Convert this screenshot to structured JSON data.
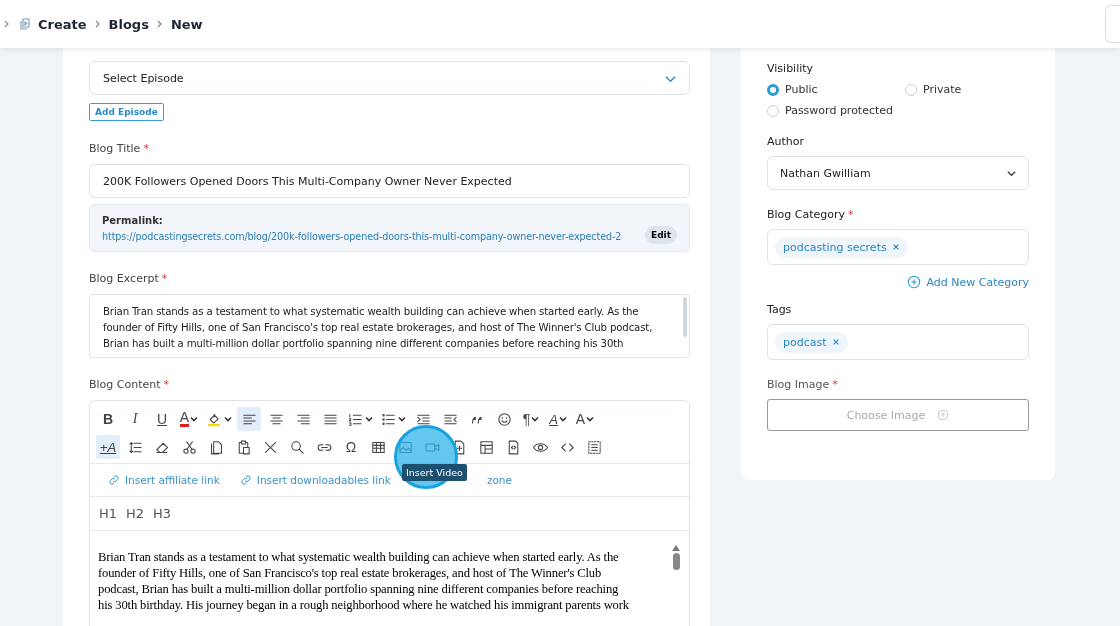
{
  "breadcrumb": [
    "Create",
    "Blogs",
    "New"
  ],
  "episode": {
    "placeholder": "Select Episode",
    "add_button": "Add Episode"
  },
  "title_field": {
    "label": "Blog Title",
    "required_mark": "*",
    "value": "200K Followers Opened Doors This Multi-Company Owner  Never Expected"
  },
  "permalink": {
    "label": "Permalink:",
    "url": "https://podcastingsecrets.com/blog/200k-followers-opened-doors-this-multi-company-owner-never-expected-2",
    "edit_button": "Edit"
  },
  "excerpt": {
    "label": "Blog Excerpt",
    "required_mark": "*",
    "lines": [
      "Brian Tran stands as a testament to what systematic wealth building can achieve when started early. As the",
      "founder of Fifty Hills, one of San Francisco's top real estate brokerages, and host of The Winner's Club podcast,",
      "Brian has built a multi-million dollar portfolio spanning nine different companies before reaching his 30th"
    ]
  },
  "content": {
    "label": "Blog Content",
    "required_mark": "*",
    "toolbar_rows": [
      [
        {
          "kind": "bold",
          "glyph": "B",
          "selected": false,
          "dropdown": false
        },
        {
          "kind": "italic",
          "glyph": "I",
          "selected": false,
          "dropdown": false
        },
        {
          "kind": "underline",
          "glyph": "U",
          "selected": false,
          "dropdown": false
        },
        {
          "kind": "font-color",
          "glyph": "A",
          "selected": false,
          "dropdown": true
        },
        {
          "kind": "highlight",
          "selected": false,
          "dropdown": true
        },
        {
          "kind": "align-left",
          "selected": true,
          "dropdown": false
        },
        {
          "kind": "align-center",
          "selected": false,
          "dropdown": false
        },
        {
          "kind": "align-right",
          "selected": false,
          "dropdown": false
        },
        {
          "kind": "justify",
          "selected": false,
          "dropdown": false
        },
        {
          "kind": "ordered-list",
          "selected": false,
          "dropdown": true
        },
        {
          "kind": "bullet-list",
          "selected": false,
          "dropdown": true
        },
        {
          "kind": "indent",
          "selected": false,
          "dropdown": false
        },
        {
          "kind": "outdent",
          "selected": false,
          "dropdown": false
        },
        {
          "kind": "quote",
          "selected": false,
          "dropdown": false
        },
        {
          "kind": "emoji",
          "selected": false,
          "dropdown": false
        },
        {
          "kind": "paragraph",
          "glyph": "¶",
          "selected": false,
          "dropdown": true
        },
        {
          "kind": "text-direction",
          "glyph": "A",
          "selected": false,
          "dropdown": true
        },
        {
          "kind": "font-size",
          "glyph": "A",
          "selected": false,
          "dropdown": true
        }
      ],
      [
        {
          "kind": "format-text",
          "glyph": "+A",
          "selected": true,
          "dropdown": false
        },
        {
          "kind": "line-height",
          "selected": false,
          "dropdown": false
        },
        {
          "kind": "eraser",
          "selected": false,
          "dropdown": false
        },
        {
          "kind": "cut",
          "selected": false,
          "dropdown": false
        },
        {
          "kind": "copy",
          "selected": false,
          "dropdown": false
        },
        {
          "kind": "paste",
          "selected": false,
          "dropdown": false
        },
        {
          "kind": "clear",
          "selected": false,
          "dropdown": false
        },
        {
          "kind": "search",
          "selected": false,
          "dropdown": false
        },
        {
          "kind": "link",
          "selected": false,
          "dropdown": false
        },
        {
          "kind": "omega",
          "glyph": "Ω",
          "selected": false,
          "dropdown": false
        },
        {
          "kind": "table",
          "selected": false,
          "dropdown": false
        },
        {
          "kind": "image",
          "selected": false,
          "dropdown": false
        },
        {
          "kind": "video",
          "selected": false,
          "dropdown": false
        },
        {
          "kind": "file",
          "selected": false,
          "dropdown": false
        },
        {
          "kind": "template",
          "selected": false,
          "dropdown": false
        },
        {
          "kind": "embed",
          "selected": false,
          "dropdown": false
        },
        {
          "kind": "preview",
          "selected": false,
          "dropdown": false
        },
        {
          "kind": "code",
          "selected": false,
          "dropdown": false
        },
        {
          "kind": "select-all",
          "selected": false,
          "dropdown": false
        }
      ]
    ],
    "tooltip": "Insert Video",
    "links": [
      "Insert affiliate link",
      "Insert downloadables link"
    ],
    "partial_link": "zone",
    "headings": [
      "H1",
      "H2",
      "H3"
    ],
    "body_lines": [
      "Brian Tran stands as a testament to what systematic wealth building can achieve when started early. As the",
      "founder of Fifty Hills, one of San Francisco's top real estate brokerages, and host of The Winner's Club",
      "podcast, Brian has built a multi-million dollar portfolio spanning nine different companies before reaching",
      "his 30th birthday. His journey began in a rough neighborhood where he watched his immigrant parents work"
    ]
  },
  "visibility": {
    "label": "Visibility",
    "options": [
      {
        "label": "Public",
        "selected": true
      },
      {
        "label": "Private",
        "selected": false
      },
      {
        "label": "Password protected",
        "selected": false
      }
    ]
  },
  "author": {
    "label": "Author",
    "value": "Nathan Gwilliam"
  },
  "category": {
    "label": "Blog Category",
    "required_mark": "*",
    "chips": [
      "podcasting secrets"
    ],
    "add_link": "Add New Category"
  },
  "tags": {
    "label": "Tags",
    "chips": [
      "podcast"
    ]
  },
  "image": {
    "label": "Blog Image",
    "required_mark": "*",
    "button": "Choose Image"
  }
}
